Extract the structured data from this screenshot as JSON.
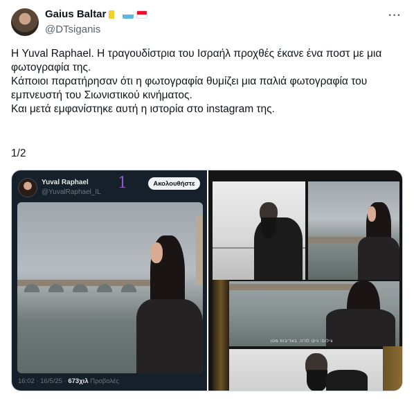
{
  "author": {
    "name": "Gaius Baltar",
    "handle": "@DTsiganis",
    "flags": [
      "vatican-flag-icon",
      "san-marino-flag-icon",
      "monaco-flag-icon"
    ]
  },
  "more_label": "···",
  "tweet": {
    "paragraphs": [
      "Η Yuval Raphael. Η τραγουδίστρια του Ισραήλ προχθές έκανε ένα ποστ με μια φωτογραφία της.",
      "Κάποιοι παρατήρησαν ότι η φωτογραφία θυμίζει μια παλιά φωτογραφία του εμπνευστή του Σιωνιστικού κινήματος.",
      "Και μετά εμφανίστηκε αυτή η ιστορία στο instagram της."
    ],
    "counter": "1/2"
  },
  "embedded": {
    "name": "Yuval Raphael",
    "handle": "@YuvalRaphael_IL",
    "number_mark": "1",
    "follow_label": "Ακολουθήστε",
    "time": "16:02 · 16/5/25 · ",
    "views": "673χιλ",
    "views_label": " Προβολές"
  },
  "right_caption": "צילום: ניקו לה'ה, באדיבות מטן"
}
